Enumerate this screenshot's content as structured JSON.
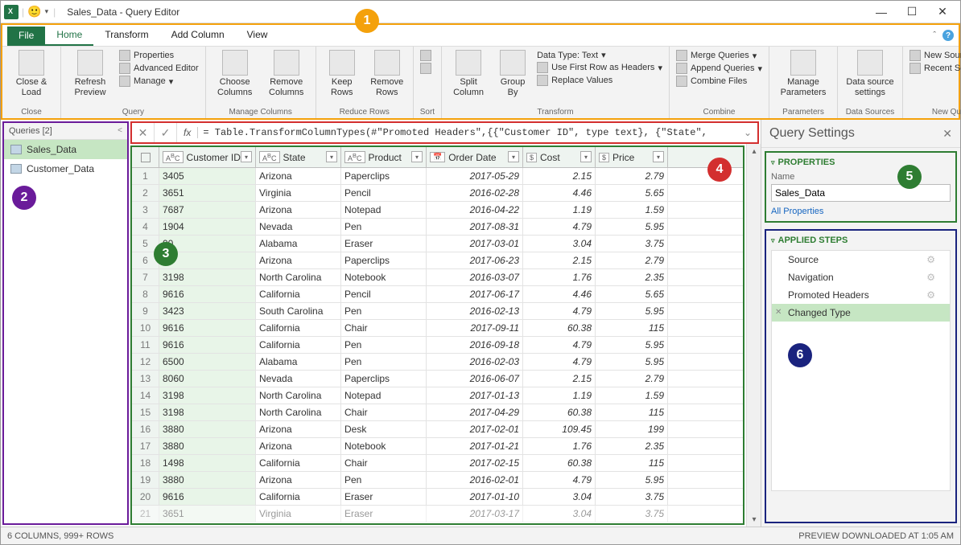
{
  "window": {
    "title": "Sales_Data - Query Editor"
  },
  "tabs": {
    "file": "File",
    "home": "Home",
    "transform": "Transform",
    "add_column": "Add Column",
    "view": "View"
  },
  "ribbon": {
    "close_load": "Close &\nLoad",
    "close_label": "Close",
    "refresh": "Refresh\nPreview",
    "properties": "Properties",
    "advanced_editor": "Advanced Editor",
    "manage": "Manage",
    "query_label": "Query",
    "choose_cols": "Choose\nColumns",
    "remove_cols": "Remove\nColumns",
    "manage_cols_label": "Manage Columns",
    "keep_rows": "Keep\nRows",
    "remove_rows": "Remove\nRows",
    "reduce_rows_label": "Reduce Rows",
    "sort_label": "Sort",
    "split_col": "Split\nColumn",
    "group_by": "Group\nBy",
    "data_type": "Data Type: Text",
    "first_row": "Use First Row as Headers",
    "replace": "Replace Values",
    "transform_label": "Transform",
    "merge": "Merge Queries",
    "append": "Append Queries",
    "combine_files": "Combine Files",
    "combine_label": "Combine",
    "manage_params": "Manage\nParameters",
    "params_label": "Parameters",
    "ds_settings": "Data source\nsettings",
    "ds_label": "Data Sources",
    "new_source": "New Source",
    "recent_sources": "Recent Sources",
    "new_query_label": "New Query"
  },
  "queries_pane": {
    "header": "Queries [2]",
    "items": [
      "Sales_Data",
      "Customer_Data"
    ]
  },
  "formula": "= Table.TransformColumnTypes(#\"Promoted Headers\",{{\"Customer ID\", type text}, {\"State\",",
  "table": {
    "columns": [
      {
        "name": "Customer ID",
        "type": "ABC"
      },
      {
        "name": "State",
        "type": "ABC"
      },
      {
        "name": "Product",
        "type": "ABC"
      },
      {
        "name": "Order Date",
        "type": "📅"
      },
      {
        "name": "Cost",
        "type": "$"
      },
      {
        "name": "Price",
        "type": "$"
      }
    ],
    "rows": [
      [
        "3405",
        "Arizona",
        "Paperclips",
        "2017-05-29",
        "2.15",
        "2.79"
      ],
      [
        "3651",
        "Virginia",
        "Pencil",
        "2016-02-28",
        "4.46",
        "5.65"
      ],
      [
        "7687",
        "Arizona",
        "Notepad",
        "2016-04-22",
        "1.19",
        "1.59"
      ],
      [
        "1904",
        "Nevada",
        "Pen",
        "2017-08-31",
        "4.79",
        "5.95"
      ],
      [
        "00",
        "Alabama",
        "Eraser",
        "2017-03-01",
        "3.04",
        "3.75"
      ],
      [
        "87",
        "Arizona",
        "Paperclips",
        "2017-06-23",
        "2.15",
        "2.79"
      ],
      [
        "3198",
        "North Carolina",
        "Notebook",
        "2016-03-07",
        "1.76",
        "2.35"
      ],
      [
        "9616",
        "California",
        "Pencil",
        "2017-06-17",
        "4.46",
        "5.65"
      ],
      [
        "3423",
        "South Carolina",
        "Pen",
        "2016-02-13",
        "4.79",
        "5.95"
      ],
      [
        "9616",
        "California",
        "Chair",
        "2017-09-11",
        "60.38",
        "115"
      ],
      [
        "9616",
        "California",
        "Pen",
        "2016-09-18",
        "4.79",
        "5.95"
      ],
      [
        "6500",
        "Alabama",
        "Pen",
        "2016-02-03",
        "4.79",
        "5.95"
      ],
      [
        "8060",
        "Nevada",
        "Paperclips",
        "2016-06-07",
        "2.15",
        "2.79"
      ],
      [
        "3198",
        "North Carolina",
        "Notepad",
        "2017-01-13",
        "1.19",
        "1.59"
      ],
      [
        "3198",
        "North Carolina",
        "Chair",
        "2017-04-29",
        "60.38",
        "115"
      ],
      [
        "3880",
        "Arizona",
        "Desk",
        "2017-02-01",
        "109.45",
        "199"
      ],
      [
        "3880",
        "Arizona",
        "Notebook",
        "2017-01-21",
        "1.76",
        "2.35"
      ],
      [
        "1498",
        "California",
        "Chair",
        "2017-02-15",
        "60.38",
        "115"
      ],
      [
        "3880",
        "Arizona",
        "Pen",
        "2016-02-01",
        "4.79",
        "5.95"
      ],
      [
        "9616",
        "California",
        "Eraser",
        "2017-01-10",
        "3.04",
        "3.75"
      ],
      [
        "3651",
        "Virginia",
        "Eraser",
        "2017-03-17",
        "3.04",
        "3.75"
      ]
    ]
  },
  "query_settings": {
    "title": "Query Settings",
    "props_title": "PROPERTIES",
    "name_label": "Name",
    "name_value": "Sales_Data",
    "all_props": "All Properties",
    "steps_title": "APPLIED STEPS",
    "steps": [
      {
        "label": "Source",
        "gear": true
      },
      {
        "label": "Navigation",
        "gear": true
      },
      {
        "label": "Promoted Headers",
        "gear": true
      },
      {
        "label": "Changed Type",
        "gear": false,
        "active": true
      }
    ]
  },
  "statusbar": {
    "left": "6 COLUMNS, 999+ ROWS",
    "right": "PREVIEW DOWNLOADED AT 1:05 AM"
  },
  "callouts": [
    "1",
    "2",
    "3",
    "4",
    "5",
    "6"
  ]
}
